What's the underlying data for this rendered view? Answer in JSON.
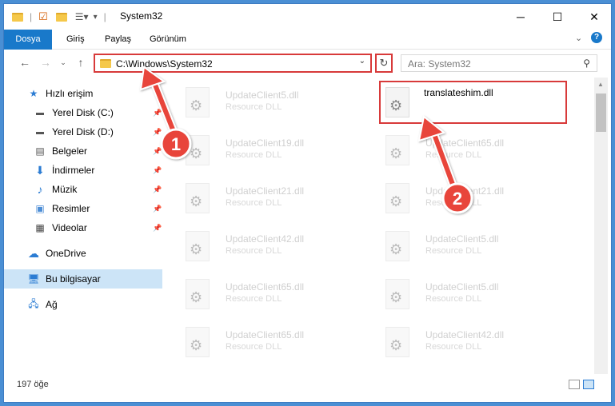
{
  "window": {
    "title": "System32",
    "minimize": "─",
    "maximize": "☐",
    "close": "✕"
  },
  "ribbon": {
    "tabs": [
      "Dosya",
      "Giriş",
      "Paylaş",
      "Görünüm"
    ]
  },
  "address": {
    "path": "C:\\Windows\\System32"
  },
  "search": {
    "placeholder": "Ara: System32"
  },
  "sidebar": {
    "items": [
      {
        "label": "Hızlı erişim",
        "icon": "star-icon"
      },
      {
        "label": "Yerel Disk (C:)",
        "icon": "drive-icon"
      },
      {
        "label": "Yerel Disk (D:)",
        "icon": "drive-icon"
      },
      {
        "label": "Belgeler",
        "icon": "documents-icon"
      },
      {
        "label": "İndirmeler",
        "icon": "download-icon"
      },
      {
        "label": "Müzik",
        "icon": "music-icon"
      },
      {
        "label": "Resimler",
        "icon": "pictures-icon"
      },
      {
        "label": "Videolar",
        "icon": "video-icon"
      },
      {
        "label": "OneDrive",
        "icon": "cloud-icon"
      },
      {
        "label": "Bu bilgisayar",
        "icon": "computer-icon"
      },
      {
        "label": "Ağ",
        "icon": "network-icon"
      }
    ]
  },
  "files": [
    {
      "name": "UpdateClient5.dll",
      "type": "Resource DLL"
    },
    {
      "name": "translateshim.dll",
      "type": ""
    },
    {
      "name": "UpdateClient19.dll",
      "type": "Resource DLL"
    },
    {
      "name": "UpdateClient65.dll",
      "type": "Resource DLL"
    },
    {
      "name": "UpdateClient21.dll",
      "type": "Resource DLL"
    },
    {
      "name": "UpdateClient21.dll",
      "type": "Resource DLL"
    },
    {
      "name": "UpdateClient42.dll",
      "type": "Resource DLL"
    },
    {
      "name": "UpdateClient5.dll",
      "type": "Resource DLL"
    },
    {
      "name": "UpdateClient65.dll",
      "type": "Resource DLL"
    },
    {
      "name": "UpdateClient5.dll",
      "type": "Resource DLL"
    },
    {
      "name": "UpdateClient65.dll",
      "type": "Resource DLL"
    },
    {
      "name": "UpdateClient42.dll",
      "type": "Resource DLL"
    }
  ],
  "status": {
    "count": "197 öğe"
  },
  "annotations": {
    "step1": "1",
    "step2": "2",
    "color": "#e8443a"
  }
}
